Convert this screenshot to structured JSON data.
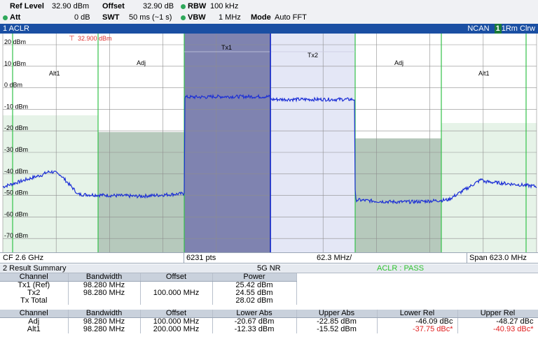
{
  "settings": {
    "ref_level_label": "Ref Level",
    "ref_level_value": "32.90 dBm",
    "offset_label": "Offset",
    "offset_value": "32.90 dB",
    "rbw_label": "RBW",
    "rbw_value": "100 kHz",
    "att_label": "Att",
    "att_value": "0 dB",
    "swt_label": "SWT",
    "swt_value": "50 ms (~1 s)",
    "vbw_label": "VBW",
    "vbw_value": "1 MHz",
    "mode_label": "Mode",
    "mode_value": "Auto FFT"
  },
  "window1": {
    "title": "1 ACLR",
    "status_ncan": "NCAN",
    "trace_number": "1",
    "trace_mode": "1Rm Clrw"
  },
  "plot": {
    "ref_marker_label": "32.900 dBm",
    "y_ticks": [
      "20 dBm",
      "10 dBm",
      "0 dBm",
      "-10 dBm",
      "-20 dBm",
      "-30 dBm",
      "-40 dBm",
      "-50 dBm",
      "-60 dBm",
      "-70 dBm"
    ],
    "channel_labels": {
      "alt1_left": "Alt1",
      "adj_left": "Adj",
      "tx1": "Tx1",
      "tx2": "Tx2",
      "adj_right": "Adj",
      "alt1_right": "Alt1"
    },
    "colors": {
      "trace": "#1c2fd6",
      "tx_band": "#7f83b0",
      "tx2_band": "#e4e7f6",
      "adj_band": "#b6c9bc",
      "alt_band": "#e6f3e8",
      "channel_line": "#34c24a",
      "grid": "#8e8e8e",
      "ref_marker": "#e03030"
    }
  },
  "footer": {
    "cf": "CF 2.6 GHz",
    "points": "6231 pts",
    "div": "62.3 MHz/",
    "span": "Span 623.0 MHz"
  },
  "summary": {
    "title": "2 Result Summary",
    "standard": "5G NR",
    "status": "ACLR : PASS",
    "status_color": "#2fc22f",
    "tx_header": [
      "Channel",
      "Bandwidth",
      "Offset",
      "Power"
    ],
    "tx_rows": [
      [
        "Tx1 (Ref)",
        "98.280 MHz",
        "",
        "25.42 dBm"
      ],
      [
        "Tx2",
        "98.280 MHz",
        "100.000 MHz",
        "24.55 dBm"
      ],
      [
        "Tx Total",
        "",
        "",
        "28.02 dBm"
      ]
    ],
    "adj_header": [
      "Channel",
      "Bandwidth",
      "Offset",
      "Lower Abs",
      "Upper Abs",
      "Lower Rel",
      "Upper Rel"
    ],
    "adj_rows": [
      [
        "Adj",
        "98.280 MHz",
        "100.000 MHz",
        "-20.67 dBm",
        "-22.85 dBm",
        "-46.09 dBc",
        "-48.27 dBc"
      ],
      [
        "Alt1",
        "98.280 MHz",
        "200.000 MHz",
        "-12.33 dBm",
        "-15.52 dBm",
        "-37.75 dBc*",
        "-40.93 dBc*"
      ]
    ]
  }
}
